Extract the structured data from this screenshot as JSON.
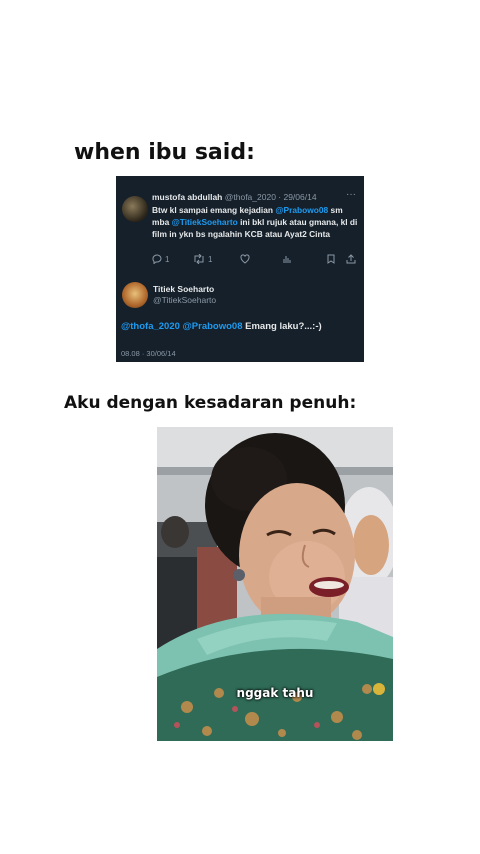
{
  "captions": {
    "top": "when ibu said:",
    "middle": "Aku dengan kesadaran penuh:"
  },
  "tweet": {
    "author_name": "mustofa abdullah",
    "author_handle": "@thofa_2020 · 29/06/14",
    "more_icon": "···",
    "body_parts": [
      {
        "text": "Btw kl sampai emang kejadian ",
        "mention": false
      },
      {
        "text": "@Prabowo08",
        "mention": true
      },
      {
        "text": " sm mba ",
        "mention": false
      },
      {
        "text": "@TitiekSoeharto",
        "mention": true
      },
      {
        "text": " ini bkl rujuk atau gmana, kl di film in ykn bs ngalahin KCB atau Ayat2 Cinta",
        "mention": false
      }
    ],
    "actions": {
      "reply_count": "1",
      "retweet_count": "1"
    },
    "reply": {
      "author_name": "Titiek Soeharto",
      "author_handle": "@TitiekSoeharto",
      "mention1": "@thofa_2020",
      "mention2": "@Prabowo08",
      "text": " Emang laku?...:-)",
      "timestamp": "08.08 · 30/06/14"
    }
  },
  "photo": {
    "subtitle": "nggak tahu"
  },
  "colors": {
    "tweet_bg": "#15202b",
    "mention": "#1d9bf0",
    "muted": "#8b98a5"
  }
}
